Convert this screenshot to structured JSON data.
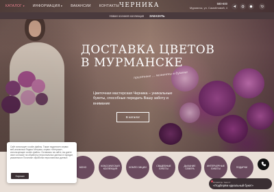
{
  "nav": {
    "items": [
      {
        "label": "КАТАЛОГ",
        "active": true,
        "dropdown": true
      },
      {
        "label": "ИНФОРМАЦИЯ",
        "active": false,
        "dropdown": true
      },
      {
        "label": "ВАКАНСИИ",
        "active": false,
        "dropdown": false
      },
      {
        "label": "КОНТАКТЫ",
        "active": false,
        "dropdown": false
      }
    ]
  },
  "logo": {
    "text": "ЧЕРНИКА",
    "sub": "«"
  },
  "contacts": {
    "phone": "580-600",
    "address": "Мурманск, ул. Самойловой, 4"
  },
  "social_icons": [
    "telegram-icon",
    "vk-icon",
    "whatsapp-icon",
    "cart-icon"
  ],
  "announcement": {
    "text": "Новая осенняя коллекция",
    "link": "ЗАКАЗАТЬ"
  },
  "hero": {
    "headline_line1": "Доставка цветов",
    "headline_line2": "в Мурманске",
    "script": "приятные ... моменты в букете",
    "subtitle": "Цветочная мастерская Черника – уникальные букеты, способные передать Вашу заботу и внимание",
    "cta": "В каталог"
  },
  "categories": [
    "МОНО",
    "КЛАССИЧЕСКАЯ КОЛЛЕКЦИЯ",
    "КОМПО ЗИЦИИ",
    "СВАДЕБНЫЕ БУКЕТЫ",
    "ДЫХАНИЕ СЕВЕРА",
    "ИНТЕРЬЕРНЫЕ БУКЕТЫ",
    "ПОДАРКИ"
  ],
  "cookie": {
    "text": "Сайт использует cookie-файлы. Также подключен сервис веб-аналитики Яндекс Метрика, сервис «Метрика», использующие cookie-файлы. Оставаясь на сайте, вы даете свое согласие на обработку персональных данных в порядке, указанном в Политике обработки персональных данных",
    "link": "Политике обработки персональных данных",
    "button": "Хорошо"
  },
  "call": {
    "icon": "phone-icon"
  },
  "chat": {
    "top": "ПИШИТЕ ТЕКСТ",
    "message": "«Подберём идеальный букет»"
  },
  "colors": {
    "accent": "#e8818f",
    "category_bg": "#6a4a5e",
    "strip_bg": "#e9dfd7",
    "dark": "#3a2f33"
  }
}
